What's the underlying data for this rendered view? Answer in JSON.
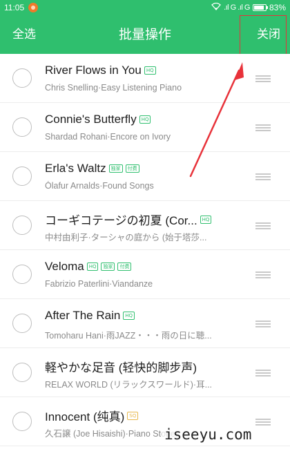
{
  "status_bar": {
    "time": "11:05",
    "wifi_icon": "wifi-icon",
    "signal_text": ".ıl G .ıl G",
    "battery_percent": "83%"
  },
  "header": {
    "select_all": "全选",
    "title": "批量操作",
    "close": "关闭",
    "background_color": "#2fbf6e"
  },
  "songs": [
    {
      "title": "River Flows in You",
      "badges": [
        "HQ"
      ],
      "subtitle": "Chris Snelling·Easy Listening Piano"
    },
    {
      "title": "Connie's Butterfly",
      "badges": [
        "HQ"
      ],
      "subtitle": "Shardad Rohani·Encore on Ivory"
    },
    {
      "title": "Erla's Waltz",
      "badges": [
        "独家",
        "付费"
      ],
      "subtitle": "Ólafur Arnalds·Found Songs"
    },
    {
      "title": "コーギコテージの初夏 (Cor...",
      "badges": [
        "HQ"
      ],
      "subtitle": "中村由利子·ターシャの庭から (始于塔莎..."
    },
    {
      "title": "Veloma",
      "badges": [
        "HQ",
        "独家",
        "付费"
      ],
      "subtitle": "Fabrizio Paterlini·Viandanze"
    },
    {
      "title": "After The Rain",
      "badges": [
        "HQ"
      ],
      "subtitle": "Tomoharu Hani·雨JAZZ・・・雨の日に聴..."
    },
    {
      "title": "軽やかな足音 (轻快的脚步声)",
      "badges": [],
      "subtitle": "RELAX WORLD (リラックスワールド)·耳..."
    },
    {
      "title": "Innocent (纯真)",
      "badges": [
        "SQ"
      ],
      "subtitle": "久石譲 (Joe Hisaishi)·Piano Stories"
    }
  ],
  "watermark": "iseeyu.com",
  "annotation_color": "#e8323a"
}
